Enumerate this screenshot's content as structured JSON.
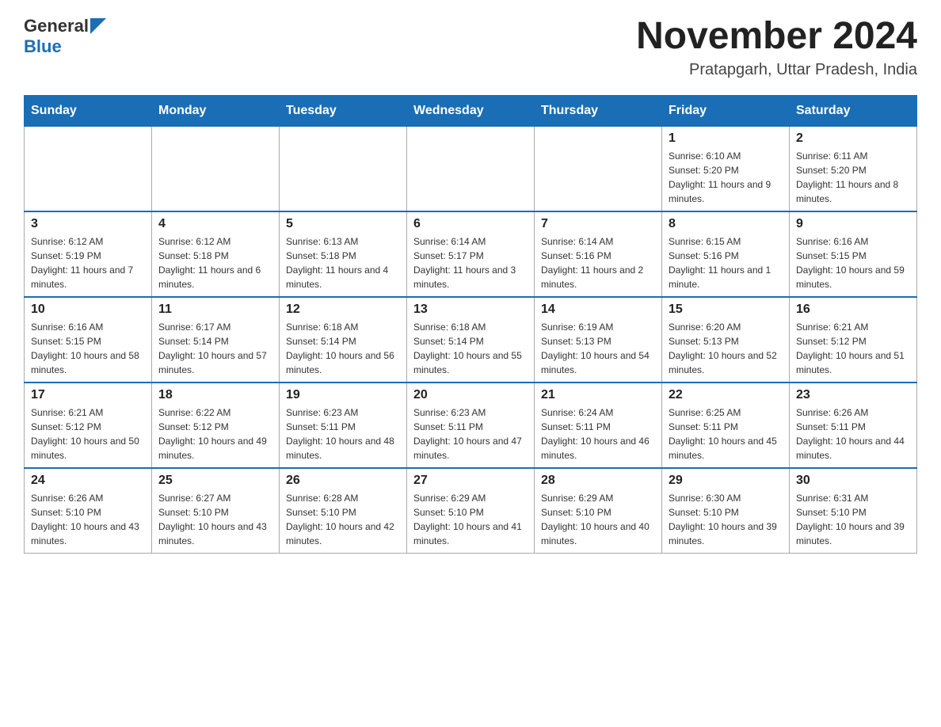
{
  "header": {
    "logo": {
      "general": "General",
      "blue": "Blue"
    },
    "title": "November 2024",
    "subtitle": "Pratapgarh, Uttar Pradesh, India"
  },
  "weekdays": [
    "Sunday",
    "Monday",
    "Tuesday",
    "Wednesday",
    "Thursday",
    "Friday",
    "Saturday"
  ],
  "weeks": [
    [
      {
        "day": "",
        "info": ""
      },
      {
        "day": "",
        "info": ""
      },
      {
        "day": "",
        "info": ""
      },
      {
        "day": "",
        "info": ""
      },
      {
        "day": "",
        "info": ""
      },
      {
        "day": "1",
        "info": "Sunrise: 6:10 AM\nSunset: 5:20 PM\nDaylight: 11 hours and 9 minutes."
      },
      {
        "day": "2",
        "info": "Sunrise: 6:11 AM\nSunset: 5:20 PM\nDaylight: 11 hours and 8 minutes."
      }
    ],
    [
      {
        "day": "3",
        "info": "Sunrise: 6:12 AM\nSunset: 5:19 PM\nDaylight: 11 hours and 7 minutes."
      },
      {
        "day": "4",
        "info": "Sunrise: 6:12 AM\nSunset: 5:18 PM\nDaylight: 11 hours and 6 minutes."
      },
      {
        "day": "5",
        "info": "Sunrise: 6:13 AM\nSunset: 5:18 PM\nDaylight: 11 hours and 4 minutes."
      },
      {
        "day": "6",
        "info": "Sunrise: 6:14 AM\nSunset: 5:17 PM\nDaylight: 11 hours and 3 minutes."
      },
      {
        "day": "7",
        "info": "Sunrise: 6:14 AM\nSunset: 5:16 PM\nDaylight: 11 hours and 2 minutes."
      },
      {
        "day": "8",
        "info": "Sunrise: 6:15 AM\nSunset: 5:16 PM\nDaylight: 11 hours and 1 minute."
      },
      {
        "day": "9",
        "info": "Sunrise: 6:16 AM\nSunset: 5:15 PM\nDaylight: 10 hours and 59 minutes."
      }
    ],
    [
      {
        "day": "10",
        "info": "Sunrise: 6:16 AM\nSunset: 5:15 PM\nDaylight: 10 hours and 58 minutes."
      },
      {
        "day": "11",
        "info": "Sunrise: 6:17 AM\nSunset: 5:14 PM\nDaylight: 10 hours and 57 minutes."
      },
      {
        "day": "12",
        "info": "Sunrise: 6:18 AM\nSunset: 5:14 PM\nDaylight: 10 hours and 56 minutes."
      },
      {
        "day": "13",
        "info": "Sunrise: 6:18 AM\nSunset: 5:14 PM\nDaylight: 10 hours and 55 minutes."
      },
      {
        "day": "14",
        "info": "Sunrise: 6:19 AM\nSunset: 5:13 PM\nDaylight: 10 hours and 54 minutes."
      },
      {
        "day": "15",
        "info": "Sunrise: 6:20 AM\nSunset: 5:13 PM\nDaylight: 10 hours and 52 minutes."
      },
      {
        "day": "16",
        "info": "Sunrise: 6:21 AM\nSunset: 5:12 PM\nDaylight: 10 hours and 51 minutes."
      }
    ],
    [
      {
        "day": "17",
        "info": "Sunrise: 6:21 AM\nSunset: 5:12 PM\nDaylight: 10 hours and 50 minutes."
      },
      {
        "day": "18",
        "info": "Sunrise: 6:22 AM\nSunset: 5:12 PM\nDaylight: 10 hours and 49 minutes."
      },
      {
        "day": "19",
        "info": "Sunrise: 6:23 AM\nSunset: 5:11 PM\nDaylight: 10 hours and 48 minutes."
      },
      {
        "day": "20",
        "info": "Sunrise: 6:23 AM\nSunset: 5:11 PM\nDaylight: 10 hours and 47 minutes."
      },
      {
        "day": "21",
        "info": "Sunrise: 6:24 AM\nSunset: 5:11 PM\nDaylight: 10 hours and 46 minutes."
      },
      {
        "day": "22",
        "info": "Sunrise: 6:25 AM\nSunset: 5:11 PM\nDaylight: 10 hours and 45 minutes."
      },
      {
        "day": "23",
        "info": "Sunrise: 6:26 AM\nSunset: 5:11 PM\nDaylight: 10 hours and 44 minutes."
      }
    ],
    [
      {
        "day": "24",
        "info": "Sunrise: 6:26 AM\nSunset: 5:10 PM\nDaylight: 10 hours and 43 minutes."
      },
      {
        "day": "25",
        "info": "Sunrise: 6:27 AM\nSunset: 5:10 PM\nDaylight: 10 hours and 43 minutes."
      },
      {
        "day": "26",
        "info": "Sunrise: 6:28 AM\nSunset: 5:10 PM\nDaylight: 10 hours and 42 minutes."
      },
      {
        "day": "27",
        "info": "Sunrise: 6:29 AM\nSunset: 5:10 PM\nDaylight: 10 hours and 41 minutes."
      },
      {
        "day": "28",
        "info": "Sunrise: 6:29 AM\nSunset: 5:10 PM\nDaylight: 10 hours and 40 minutes."
      },
      {
        "day": "29",
        "info": "Sunrise: 6:30 AM\nSunset: 5:10 PM\nDaylight: 10 hours and 39 minutes."
      },
      {
        "day": "30",
        "info": "Sunrise: 6:31 AM\nSunset: 5:10 PM\nDaylight: 10 hours and 39 minutes."
      }
    ]
  ]
}
